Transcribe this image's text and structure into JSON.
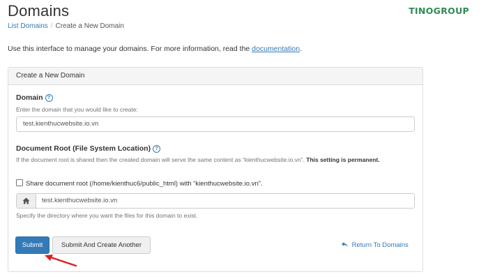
{
  "header": {
    "title": "Domains",
    "logo_text": "TINOGROUP"
  },
  "breadcrumb": {
    "parent": "List Domains",
    "separator": "/",
    "current": "Create a New Domain"
  },
  "intro": {
    "text": "Use this interface to manage your domains. For more information, read the ",
    "link": "documentation",
    "end": "."
  },
  "panel": {
    "heading": "Create a New Domain",
    "domain": {
      "label": "Domain",
      "help": "Enter the domain that you would like to create:",
      "value": "test.kienthucwebsite.io.vn"
    },
    "docroot": {
      "label": "Document Root (File System Location)",
      "note_text": "If the document root is shared then the created domain will serve the same content as “kienthucwebsite.io.vn”. ",
      "note_bold": "This setting is permanent.",
      "share_label": "Share document root (/home/kienthuc6/public_html) with “kienthucwebsite.io.vn”.",
      "share_checked": false,
      "value": "test.kienthucwebsite.io.vn",
      "help": "Specify the directory where you want the files for this domain to exist."
    },
    "buttons": {
      "submit": "Submit",
      "submit_another": "Submit And Create Another",
      "return": "Return To Domains"
    }
  },
  "icons": {
    "help": "question-circle-icon",
    "home": "home-icon",
    "return": "return-arrow-icon",
    "annotation": "red-arrow-icon"
  },
  "colors": {
    "primary": "#337ab7",
    "logo": "#2e8b57",
    "annotation": "#e02020"
  }
}
